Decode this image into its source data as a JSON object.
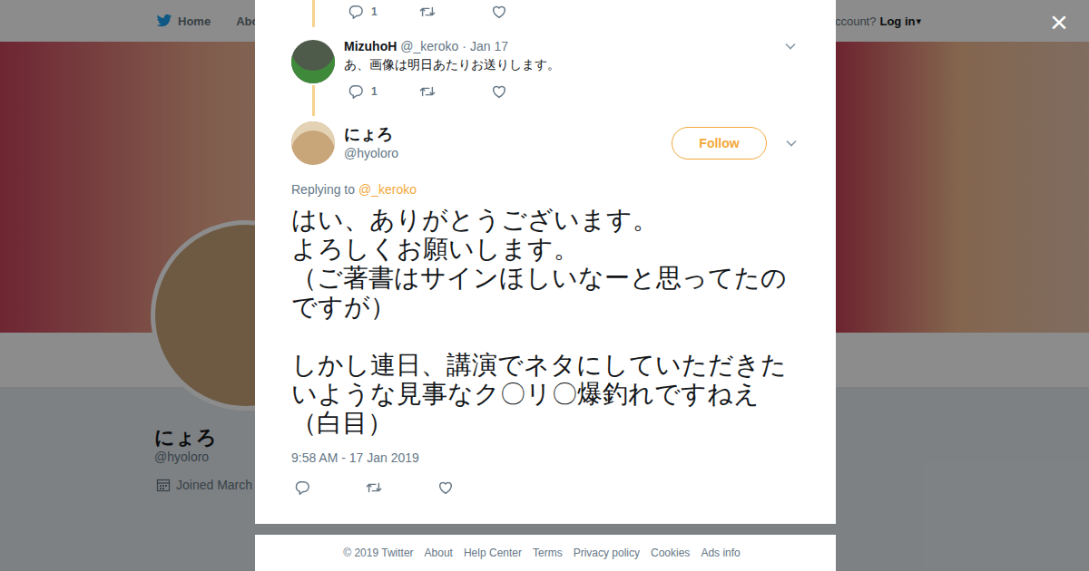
{
  "topbar": {
    "home": "Home",
    "about": "Abo",
    "account": "ccount?",
    "login": "Log in",
    "caret": "▾"
  },
  "profile": {
    "name": "にょろ",
    "handle": "@hyoloro",
    "joined": "Joined March"
  },
  "close": "×",
  "thread": [
    {
      "kind": "stub",
      "replies": "1"
    },
    {
      "kind": "tweet",
      "name": "MizuhoH",
      "handle": "@_keroko",
      "separator": "·",
      "date": "Jan 17",
      "text": "あ、画像は明日あたりお送りします。",
      "replies": "1"
    }
  ],
  "tweet": {
    "name": "にょろ",
    "handle": "@hyoloro",
    "follow": "Follow",
    "replying_label": "Replying to",
    "replying_to": "@_keroko",
    "text": "はい、ありがとうございます。\nよろしくお願いします。\n（ご著書はサインほしいなーと思ってたのですが）\n\nしかし連日、講演でネタにしていただきたいような見事なク〇リ〇爆釣れですねえ（白目）",
    "timestamp": "9:58 AM - 17 Jan 2019"
  },
  "footer": [
    "© 2019 Twitter",
    "About",
    "Help Center",
    "Terms",
    "Privacy policy",
    "Cookies",
    "Ads info"
  ]
}
